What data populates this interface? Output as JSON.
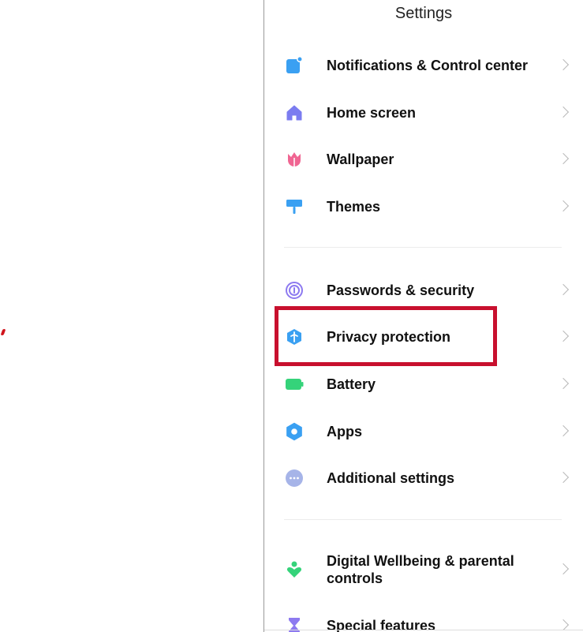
{
  "screen": {
    "title": "Settings"
  },
  "items": [
    {
      "label": "Notifications & Control center",
      "icon": "notification-icon",
      "color": "#3aa0f2"
    },
    {
      "label": "Home screen",
      "icon": "home-icon",
      "color": "#7b7cf0"
    },
    {
      "label": "Wallpaper",
      "icon": "tulip-icon",
      "color": "#f06592"
    },
    {
      "label": "Themes",
      "icon": "paint-roller-icon",
      "color": "#3aa0f2"
    },
    {
      "label": "Passwords & security",
      "icon": "fingerprint-icon",
      "color": "#8d7af0"
    },
    {
      "label": "Privacy protection",
      "icon": "shield-icon",
      "color": "#3aa0f2"
    },
    {
      "label": "Battery",
      "icon": "battery-icon",
      "color": "#35d37a"
    },
    {
      "label": "Apps",
      "icon": "gear-icon",
      "color": "#3aa0f2"
    },
    {
      "label": "Additional settings",
      "icon": "more-icon",
      "color": "#a6b4e8"
    },
    {
      "label": "Digital Wellbeing & parental controls",
      "icon": "wellbeing-icon",
      "color": "#35d37a"
    },
    {
      "label": "Special features",
      "icon": "hourglass-icon",
      "color": "#8d7af0"
    }
  ],
  "annotation": {
    "highlight_color": "#c8102e"
  }
}
